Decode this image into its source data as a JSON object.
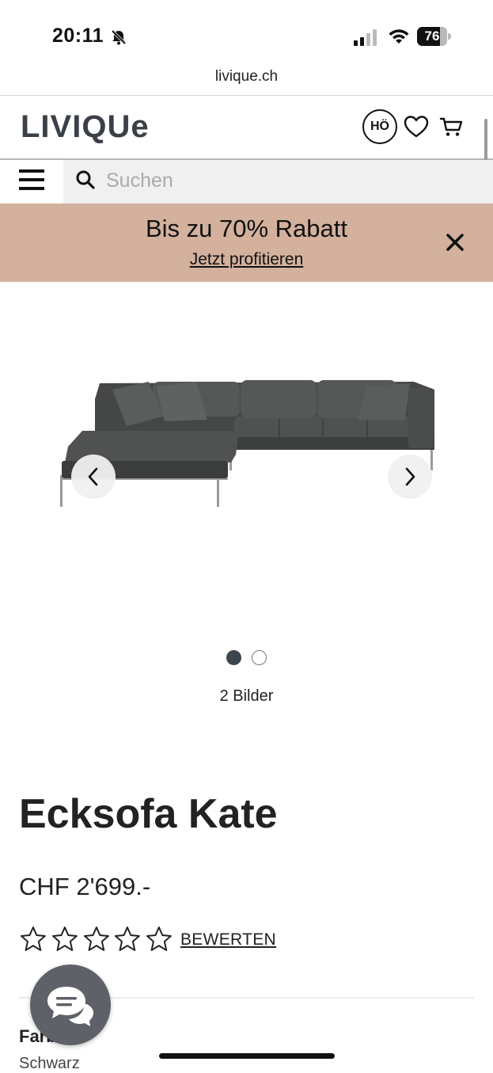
{
  "status_bar": {
    "time": "20:11",
    "battery_percent": "76",
    "battery_level": 0.76
  },
  "browser": {
    "url": "livique.ch"
  },
  "header": {
    "logo": "LIVIQUe",
    "account_initials": "HÖ",
    "icons": [
      "heart-icon",
      "cart-icon",
      "menu-icon",
      "search-icon"
    ]
  },
  "search": {
    "placeholder": "Suchen",
    "value": ""
  },
  "promo": {
    "title": "Bis zu 70% Rabatt",
    "link": "Jetzt profitieren",
    "background": "#d3b19d"
  },
  "gallery": {
    "image_count_label": "2 Bilder",
    "total_images": 2,
    "current_index": 1,
    "product_color": "#3f4240"
  },
  "product": {
    "title": "Ecksofa Kate",
    "price": "CHF 2'699.-",
    "rating_stars": 5,
    "rating_value": 0,
    "rate_label": "BEWERTEN",
    "color_label": "Farbe",
    "color_value": "Schwarz"
  },
  "colors": {
    "accent_dark": "#3e444d",
    "chat_button": "#5e6167"
  }
}
